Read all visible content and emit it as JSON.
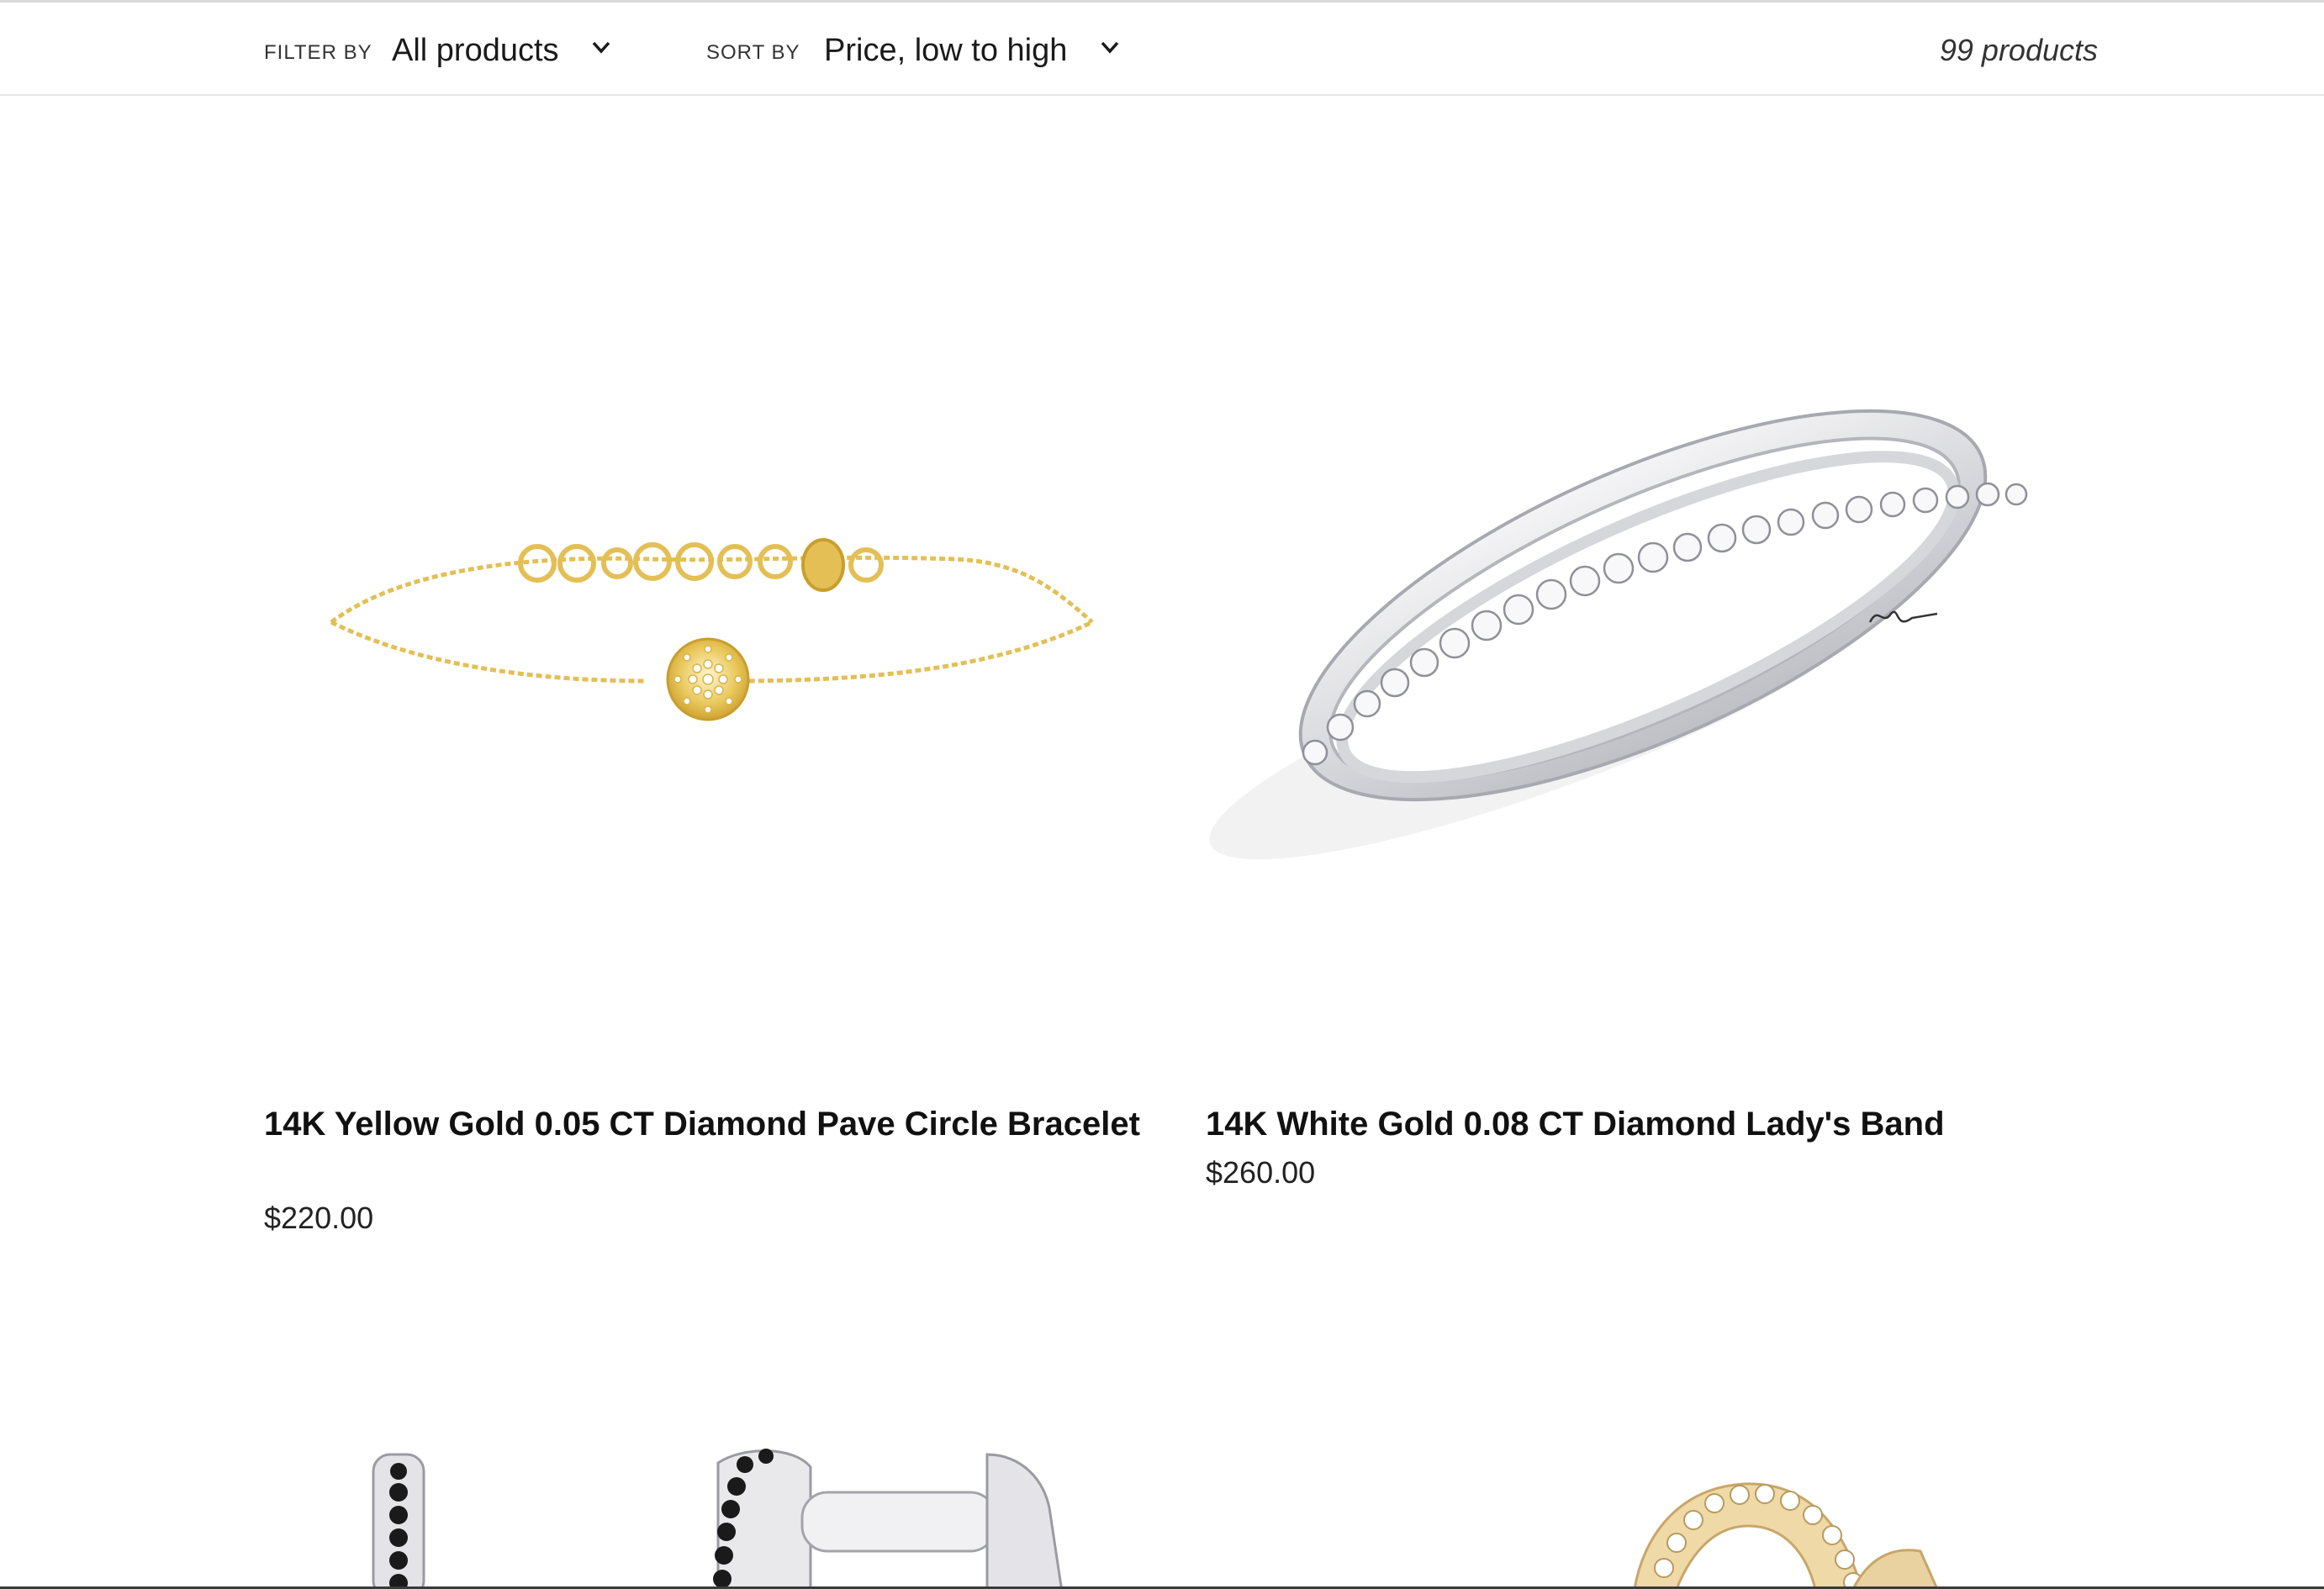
{
  "toolbar": {
    "filter_label": "FILTER BY",
    "filter_value": "All products",
    "sort_label": "SORT BY",
    "sort_value": "Price, low to high",
    "product_count": "99 products"
  },
  "products": [
    {
      "title": "14K Yellow Gold 0.05 CT Diamond Pave Circle Bracelet",
      "price": "$220.00",
      "image_icon": "gold-bracelet-image"
    },
    {
      "title": "14K White Gold 0.08 CT Diamond Lady's Band",
      "price": "$260.00",
      "image_icon": "white-gold-band-image"
    }
  ],
  "colors": {
    "gold": "#e8c860",
    "white_gold": "#d8d8dc",
    "black_diamond": "#1a1a1a",
    "text": "#111111"
  }
}
